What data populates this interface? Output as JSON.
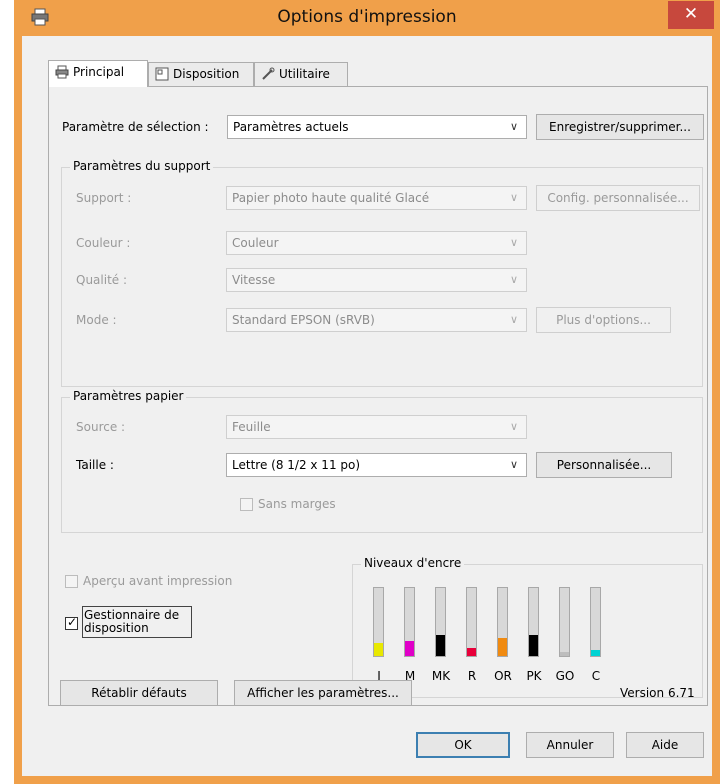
{
  "window": {
    "title": "Options d'impression",
    "title_icon": "printer-icon",
    "close_glyph": "✕"
  },
  "tabs": [
    {
      "label": "Principal",
      "icon": "printer-icon",
      "active": true
    },
    {
      "label": "Disposition",
      "icon": "layout-icon",
      "active": false
    },
    {
      "label": "Utilitaire",
      "icon": "wrench-icon",
      "active": false
    }
  ],
  "selection": {
    "label": "Paramètre de sélection :",
    "value": "Paramètres actuels",
    "save_button": "Enregistrer/supprimer..."
  },
  "media_settings": {
    "title": "Paramètres du support",
    "support_label": "Support :",
    "support_value": "Papier photo haute qualité Glacé",
    "custom_config_button": "Config. personnalisée...",
    "color_label": "Couleur :",
    "color_value": "Couleur",
    "quality_label": "Qualité :",
    "quality_value": "Vitesse",
    "mode_label": "Mode :",
    "mode_value": "Standard EPSON (sRVB)",
    "more_options_button": "Plus d'options..."
  },
  "paper_settings": {
    "title": "Paramètres papier",
    "source_label": "Source :",
    "source_value": "Feuille",
    "size_label": "Taille :",
    "size_value": "Lettre (8 1/2 x 11 po)",
    "custom_button": "Personnalisée...",
    "borderless_label": "Sans marges"
  },
  "options": {
    "preview_label": "Aperçu avant impression",
    "preview_checked": false,
    "layout_manager_label_1": "Gestionnaire de",
    "layout_manager_label_2": "disposition",
    "layout_manager_checked": true
  },
  "ink_levels": {
    "title": "Niveaux d'encre",
    "inks": [
      {
        "label": "J",
        "level": 0.18,
        "color": "#e8e800"
      },
      {
        "label": "M",
        "level": 0.22,
        "color": "#e000c8"
      },
      {
        "label": "MK",
        "level": 0.3,
        "color": "#000000"
      },
      {
        "label": "R",
        "level": 0.12,
        "color": "#e8003a"
      },
      {
        "label": "OR",
        "level": 0.25,
        "color": "#f08a10"
      },
      {
        "label": "PK",
        "level": 0.3,
        "color": "#000000"
      },
      {
        "label": "GO",
        "level": 0.06,
        "color": "#bdbdbd"
      },
      {
        "label": "C",
        "level": 0.08,
        "color": "#00d2d2"
      }
    ]
  },
  "footer": {
    "reset_button": "Rétablir défauts",
    "show_settings_button": "Afficher les paramètres...",
    "version": "Version 6.71"
  },
  "dialog_buttons": {
    "ok": "OK",
    "cancel": "Annuler",
    "help": "Aide"
  }
}
